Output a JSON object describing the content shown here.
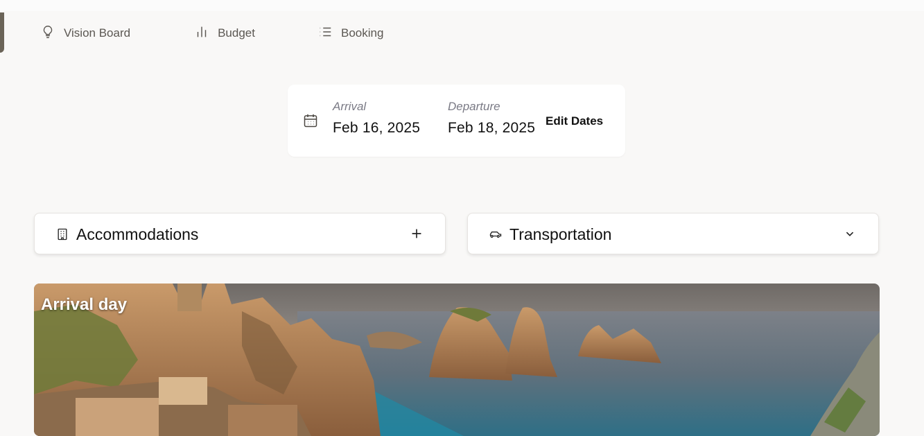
{
  "nav": {
    "items": [
      {
        "label": "Vision Board",
        "icon": "lightbulb-icon"
      },
      {
        "label": "Budget",
        "icon": "bar-chart-icon"
      },
      {
        "label": "Booking",
        "icon": "list-icon"
      }
    ]
  },
  "dates": {
    "arrival_label": "Arrival",
    "arrival_value": "Feb 16, 2025",
    "departure_label": "Departure",
    "departure_value": "Feb 18, 2025",
    "edit_label": "Edit Dates",
    "icon": "calendar-icon"
  },
  "sections": {
    "accommodations": {
      "title": "Accommodations",
      "icon": "building-icon",
      "action_icon": "plus-icon"
    },
    "transportation": {
      "title": "Transportation",
      "icon": "car-icon",
      "action_icon": "chevron-down-icon"
    }
  },
  "hero": {
    "title": "Arrival day"
  },
  "colors": {
    "background": "#f9f8f7",
    "card": "#ffffff",
    "nav_text": "#5b5752",
    "accent_edge": "#6b6458"
  }
}
